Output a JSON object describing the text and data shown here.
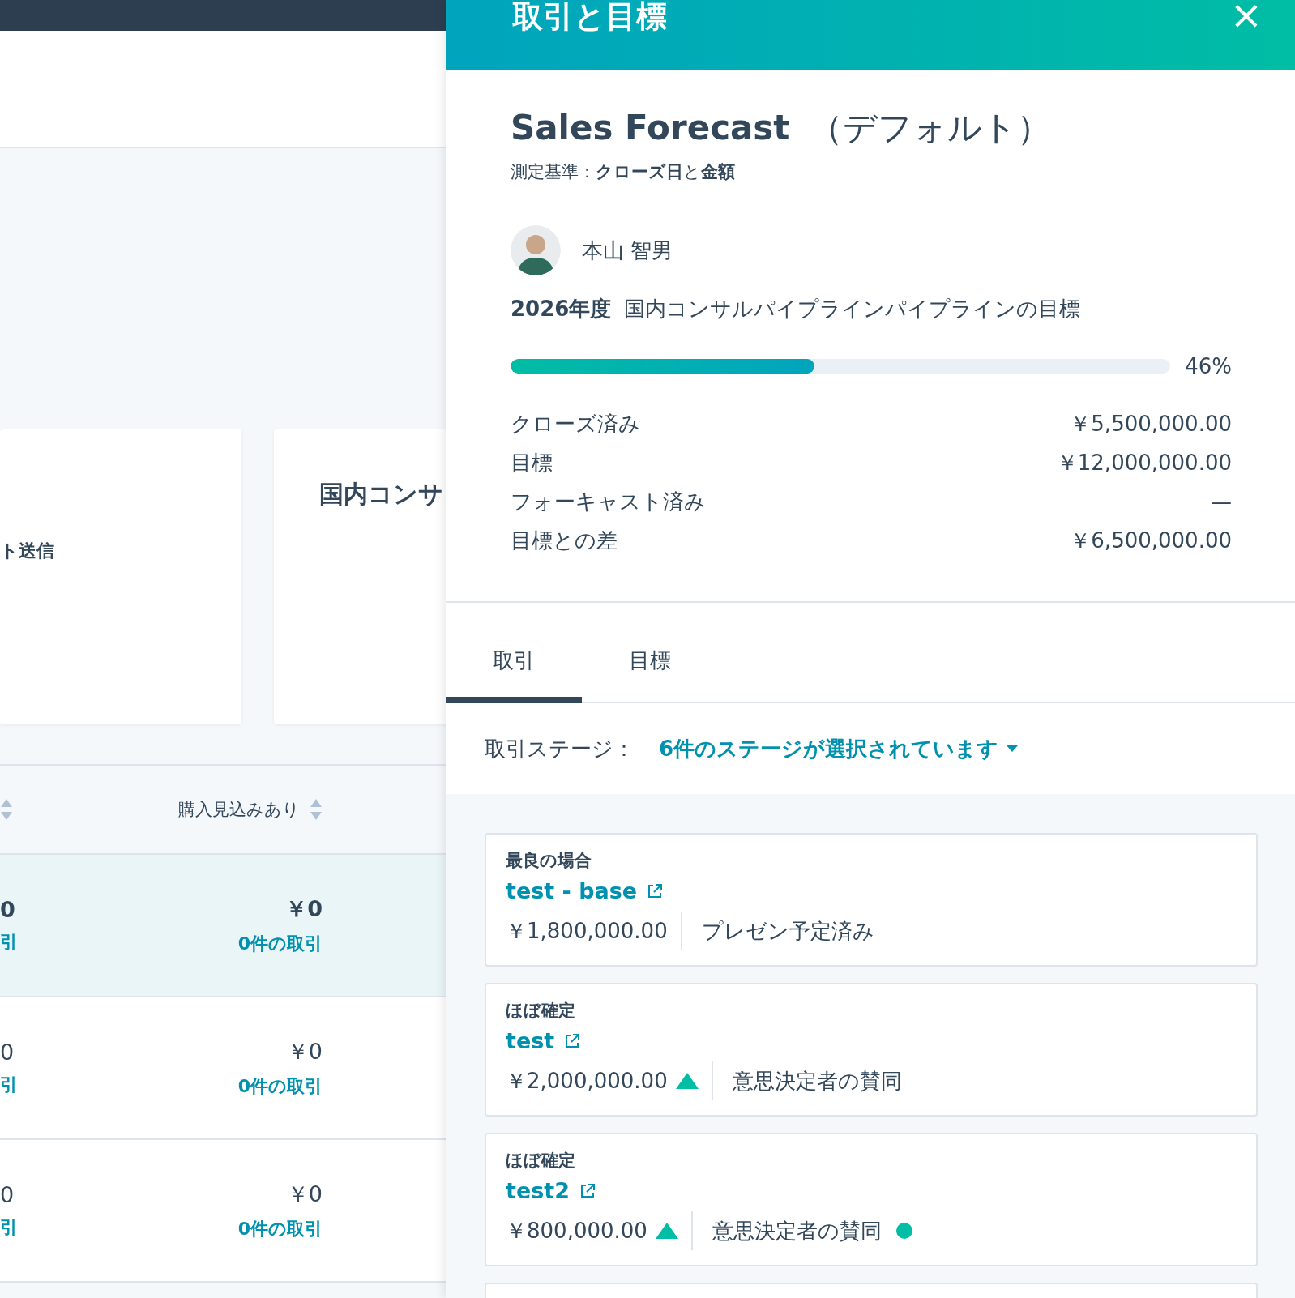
{
  "background": {
    "cards": [
      {
        "label": "ト送信"
      },
      {
        "title": "国内コンサ"
      }
    ],
    "table": {
      "columns": [
        {},
        {
          "label": "購入見込みあり"
        }
      ],
      "rows": [
        {
          "highlighted": true,
          "cells": [
            {
              "value": "0",
              "link": "引"
            },
            {
              "value": "￥0",
              "link": "0件の取引"
            }
          ]
        },
        {
          "highlighted": false,
          "cells": [
            {
              "value": "0",
              "link": "引"
            },
            {
              "value": "￥0",
              "link": "0件の取引"
            }
          ]
        },
        {
          "highlighted": false,
          "cells": [
            {
              "value": "0",
              "link": "引"
            },
            {
              "value": "￥0",
              "link": "0件の取引"
            }
          ]
        }
      ]
    }
  },
  "panel": {
    "header": {
      "title": "取引と目標",
      "close": "×"
    },
    "forecast": {
      "title": "Sales Forecast",
      "suffix": "（デフォルト）",
      "basis": "測定基準：**クローズ日**と**金額**"
    },
    "owner": {
      "name": "本山 智男"
    },
    "goal": {
      "year": "2026年度",
      "name": "国内コンサルパイプラインパイプラインの目標"
    },
    "progress": {
      "level": 0.46,
      "reading": "46%"
    },
    "metrics": [
      {
        "label": "クローズ済み",
        "value": "￥5,500,000.00"
      },
      {
        "label": "目標",
        "value": "￥12,000,000.00"
      },
      {
        "label": "フォーキャスト済み",
        "value": "—"
      },
      {
        "label": "目標との差",
        "value": "￥6,500,000.00"
      }
    ],
    "tabs": [
      {
        "label": "取引",
        "selected": true
      },
      {
        "label": "目標",
        "selected": false
      }
    ],
    "filter": {
      "label": "取引ステージ：",
      "value": "6件のステージが選択されています"
    },
    "deals": [
      {
        "category": "最良の場合",
        "name": "test - base",
        "amount": "￥1,800,000.00",
        "trend_up": false,
        "stage": "プレゼン予定済み",
        "dot": false
      },
      {
        "category": "ほぼ確定",
        "name": "test",
        "amount": "￥2,000,000.00",
        "trend_up": true,
        "stage": "意思決定者の賛同",
        "dot": false
      },
      {
        "category": "ほぼ確定",
        "name": "test2",
        "amount": "￥800,000.00",
        "trend_up": true,
        "stage": "意思決定者の賛同",
        "dot": true
      }
    ]
  }
}
